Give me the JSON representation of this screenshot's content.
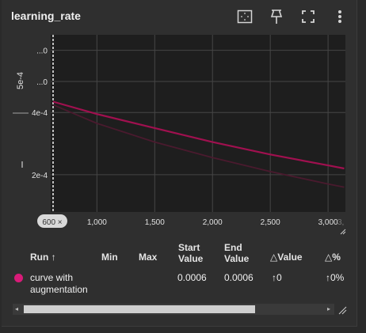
{
  "title": "learning_rate",
  "icons": [
    "fit-domain-icon",
    "pin-icon",
    "fullscreen-icon",
    "more-vert-icon"
  ],
  "y_axis_text": "5e-4",
  "colors": {
    "series1": "#a0104f",
    "series2": "#4a1a2e",
    "plot_bg": "#1e1e1e",
    "grid": "#464646",
    "accent": "#d81b78"
  },
  "chart_data": {
    "type": "line",
    "title": "learning_rate",
    "xlabel": "",
    "ylabel": "",
    "xlim": [
      600,
      3150
    ],
    "ylim": [
      8e-05,
      0.00065
    ],
    "x_ticks": [
      600,
      1000,
      1500,
      2000,
      2500,
      3000
    ],
    "x_tick_labels": [
      "600 ×",
      "1,000",
      "1,500",
      "2,000",
      "2,500",
      "3,000"
    ],
    "x_tick_partial": "3,",
    "y_ticks": [
      0.0002,
      0.0004,
      0.0005,
      0.0006
    ],
    "y_tick_labels": [
      "2e-4",
      "4e-4",
      "...0",
      "...0"
    ],
    "grid": true,
    "series": [
      {
        "x": [
          620,
          1000,
          1500,
          2000,
          2500,
          3000,
          3140
        ],
        "y": [
          0.000435,
          0.000395,
          0.00035,
          0.000305,
          0.000265,
          0.00023,
          0.00022
        ]
      },
      {
        "x": [
          620,
          1000,
          1500,
          2000,
          2500,
          3000,
          3140
        ],
        "y": [
          0.000425,
          0.000365,
          0.000305,
          0.000255,
          0.00021,
          0.00017,
          0.00016
        ]
      }
    ]
  },
  "table": {
    "headers": {
      "run": "Run ↑",
      "min": "Min",
      "max": "Max",
      "start1": "Start",
      "start2": "Value",
      "end1": "End",
      "end2": "Value",
      "dvalue": "△Value",
      "dpct": "△%"
    },
    "row": {
      "name_line1": "curve with",
      "name_line2": "augmentation",
      "min": "",
      "max": "",
      "start": "0.0006",
      "end": "0.0006",
      "dvalue": "↑0",
      "dpct": "↑0%"
    }
  }
}
